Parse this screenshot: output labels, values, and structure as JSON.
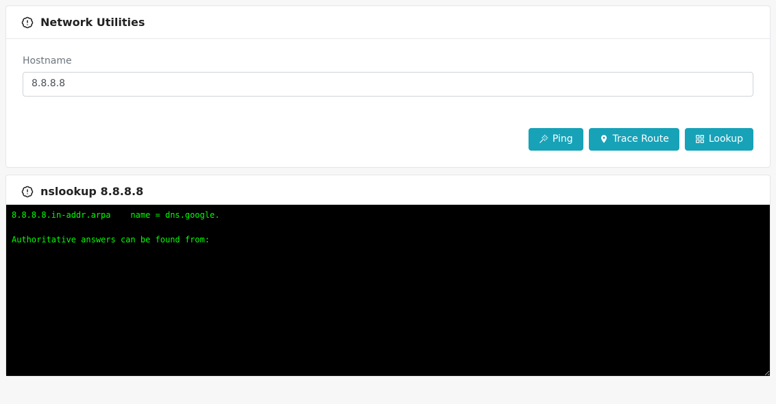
{
  "panel": {
    "title": "Network Utilities",
    "hostname_label": "Hostname",
    "hostname_value": "8.8.8.8",
    "buttons": {
      "ping": "Ping",
      "trace": "Trace Route",
      "lookup": "Lookup"
    }
  },
  "result": {
    "title": "nslookup 8.8.8.8",
    "output": "8.8.8.8.in-addr.arpa    name = dns.google.\n\nAuthoritative answers can be found from:"
  }
}
